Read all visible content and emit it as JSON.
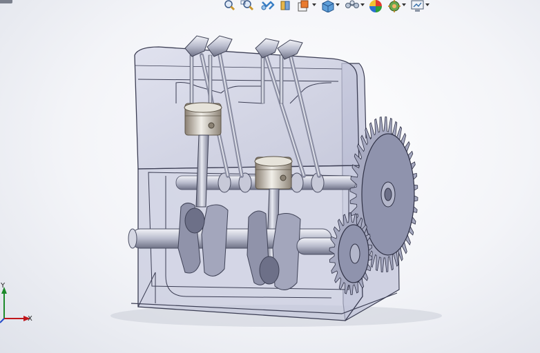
{
  "toolbar": {
    "items": [
      {
        "name": "zoom-to-fit-icon",
        "has_dropdown": false
      },
      {
        "name": "zoom-to-area-icon",
        "has_dropdown": false
      },
      {
        "name": "previous-view-icon",
        "has_dropdown": false
      },
      {
        "name": "section-view-icon",
        "has_dropdown": false
      },
      {
        "name": "view-orientation-icon",
        "has_dropdown": true
      },
      {
        "name": "display-style-icon",
        "has_dropdown": true
      },
      {
        "name": "hide-show-items-icon",
        "has_dropdown": true
      },
      {
        "name": "edit-appearance-icon",
        "has_dropdown": false
      },
      {
        "name": "apply-scene-icon",
        "has_dropdown": true
      },
      {
        "name": "view-settings-icon",
        "has_dropdown": true
      }
    ]
  },
  "triad": {
    "x_label": "X",
    "y_label": "Y"
  },
  "colors": {
    "housing_fill": "#c9cbe0",
    "housing_stroke": "#3a3c52",
    "metal_light": "#d6d8e4",
    "metal_dark": "#7e8197",
    "gear_fill": "#8f93ad",
    "x_axis": "#c0151b",
    "y_axis": "#1c8a2a"
  }
}
